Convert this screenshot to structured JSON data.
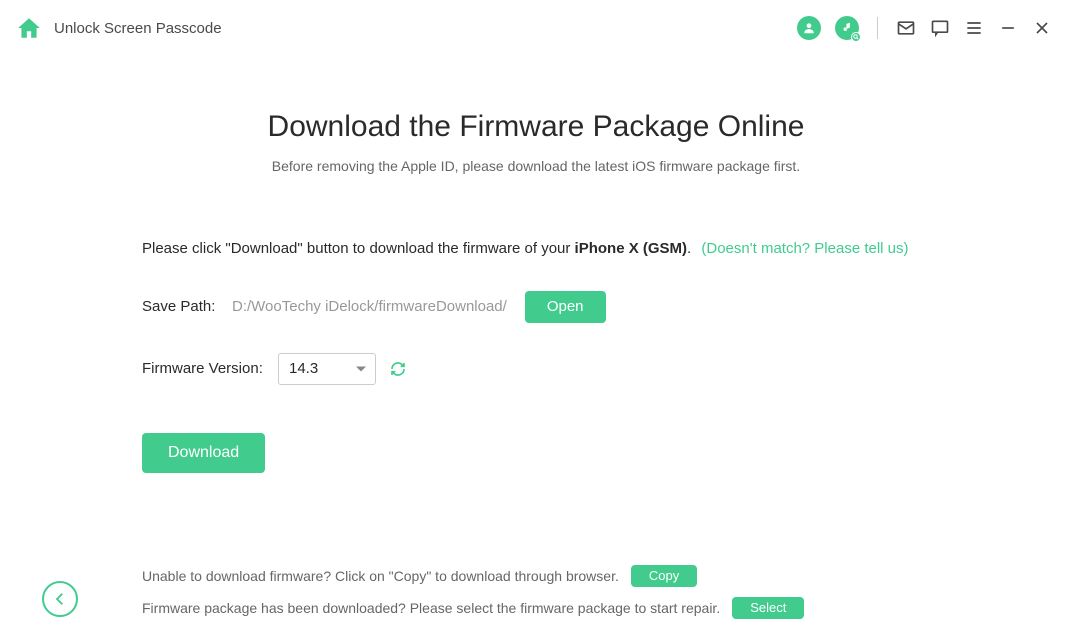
{
  "titlebar": {
    "title": "Unlock Screen Passcode"
  },
  "main": {
    "title": "Download the Firmware Package Online",
    "subtitle": "Before removing the Apple ID, please download the latest iOS firmware package first.",
    "instruction_prefix": "Please click \"Download\" button to download the firmware of your ",
    "device_model": "iPhone X (GSM)",
    "instruction_suffix": ".",
    "tell_us_link": "(Doesn't match? Please tell us)",
    "save_path_label": "Save Path:",
    "save_path_value": "D:/WooTechy iDelock/firmwareDownload/",
    "open_button": "Open",
    "firmware_version_label": "Firmware Version:",
    "firmware_version_value": "14.3",
    "download_button": "Download"
  },
  "footer": {
    "line1_text": "Unable to download firmware? Click on \"Copy\" to download through browser.",
    "copy_button": "Copy",
    "line2_text": "Firmware package has been downloaded? Please select the firmware package to start repair.",
    "select_button": "Select"
  }
}
